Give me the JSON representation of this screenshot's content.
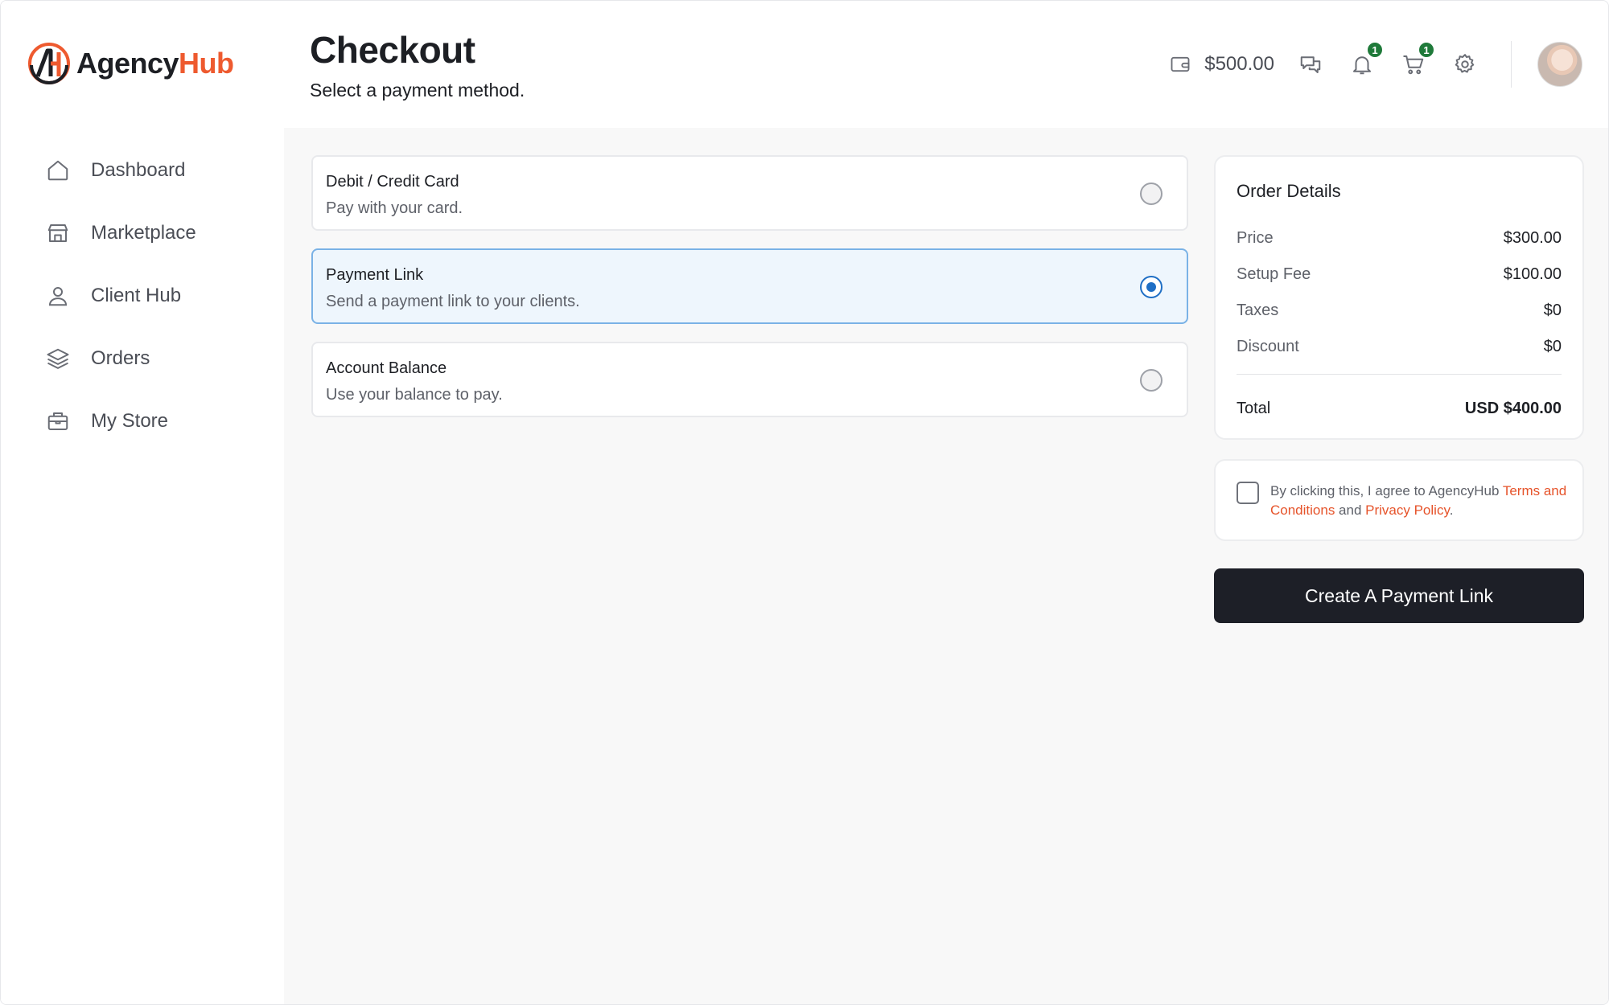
{
  "brand": {
    "name_part1": "Agency",
    "name_part2": "Hub",
    "accent": "#ee5a2f"
  },
  "sidebar": {
    "items": [
      {
        "label": "Dashboard",
        "icon": "home-icon"
      },
      {
        "label": "Marketplace",
        "icon": "store-icon"
      },
      {
        "label": "Client Hub",
        "icon": "user-icon"
      },
      {
        "label": "Orders",
        "icon": "layers-icon"
      },
      {
        "label": "My Store",
        "icon": "briefcase-icon"
      }
    ]
  },
  "header": {
    "title": "Checkout",
    "subtitle": "Select a payment method.",
    "wallet_balance": "$500.00",
    "notifications_count": "1",
    "cart_count": "1"
  },
  "payment_options": [
    {
      "title": "Debit / Credit Card",
      "desc": "Pay with your card.",
      "selected": false
    },
    {
      "title": "Payment Link",
      "desc": "Send a payment link to your clients.",
      "selected": true
    },
    {
      "title": "Account Balance",
      "desc": "Use your balance to pay.",
      "selected": false
    }
  ],
  "order": {
    "heading": "Order Details",
    "rows": [
      {
        "label": "Price",
        "value": "$300.00"
      },
      {
        "label": "Setup Fee",
        "value": "$100.00"
      },
      {
        "label": "Taxes",
        "value": "$0"
      },
      {
        "label": "Discount",
        "value": "$0"
      }
    ],
    "total_label": "Total",
    "total_value": "USD $400.00"
  },
  "agreement": {
    "prefix": "By clicking this, I agree to AgencyHub ",
    "terms": "Terms and Conditions",
    "middle": " and ",
    "privacy": "Privacy Policy",
    "suffix": "."
  },
  "cta_label": "Create A Payment Link",
  "colors": {
    "selected_border": "#7ab2e6",
    "selected_bg": "#eef6fd",
    "radio_on": "#1f6fc5",
    "badge": "#1f7a3a",
    "cta": "#1d1f27"
  }
}
